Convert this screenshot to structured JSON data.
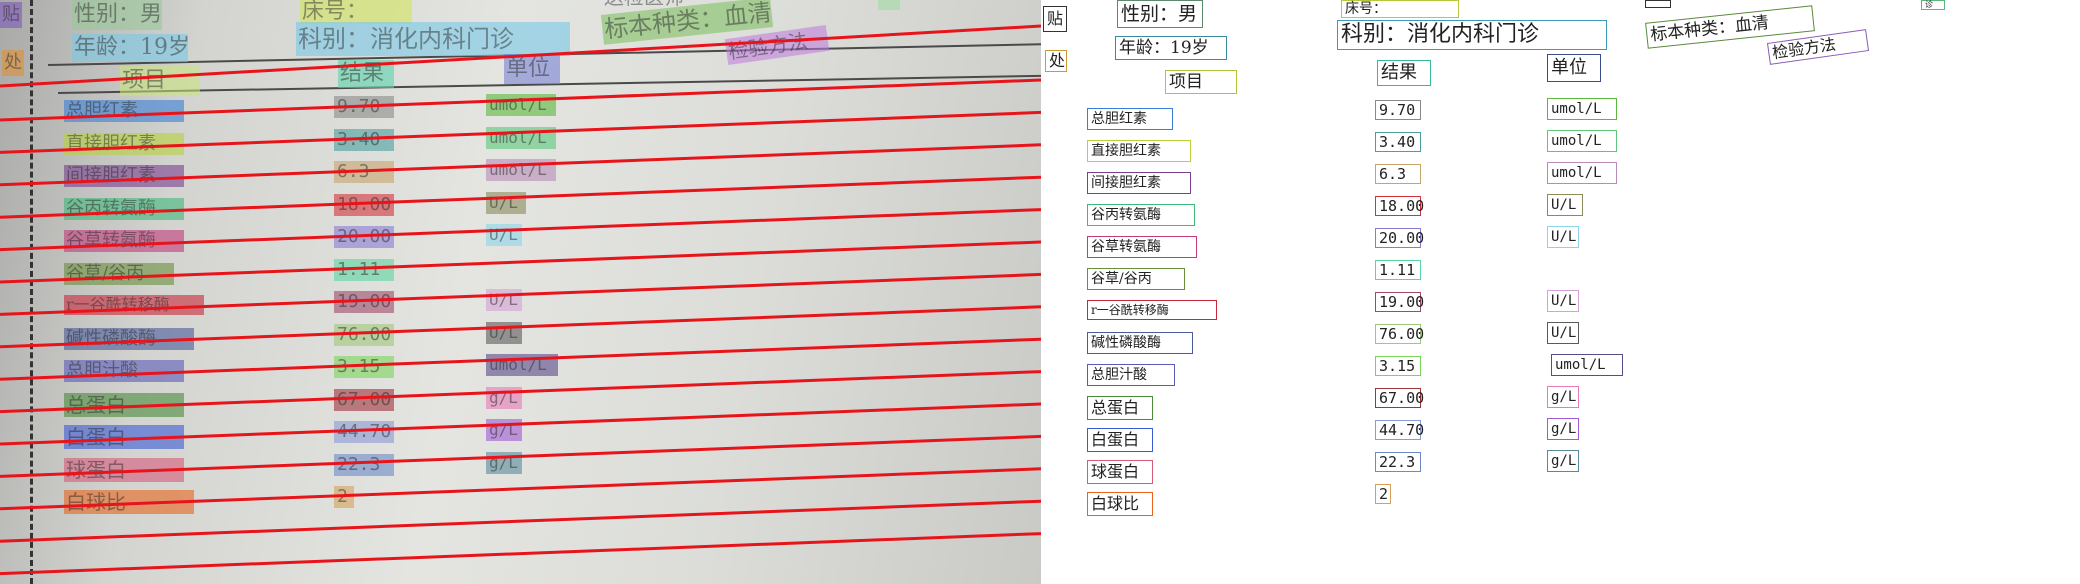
{
  "header": {
    "tie": "贴",
    "chu": "处",
    "gender": "性别：男",
    "age": "年龄：19岁",
    "bed": "床号：",
    "dept": "科别：消化内科门诊",
    "specimen": "标本种类：血清",
    "method": "检验方法",
    "hospital_fragment": "送检医师",
    "cut_fragment": "诊"
  },
  "columns": {
    "item": "项目",
    "result": "结果",
    "unit": "单位"
  },
  "rows": [
    {
      "name": "总胆红素",
      "result": "9.70",
      "unit": "umol/L"
    },
    {
      "name": "直接胆红素",
      "result": "3.40",
      "unit": "umol/L"
    },
    {
      "name": "间接胆红素",
      "result": "6.3",
      "unit": "umol/L"
    },
    {
      "name": "谷丙转氨酶",
      "result": "18.00",
      "unit": "U/L"
    },
    {
      "name": "谷草转氨酶",
      "result": "20.00",
      "unit": "U/L"
    },
    {
      "name": "谷草/谷丙",
      "result": "1.11",
      "unit": ""
    },
    {
      "name": "r一谷酰转移酶",
      "result": "19.00",
      "unit": "U/L"
    },
    {
      "name": "碱性磷酸酶",
      "result": "76.00",
      "unit": "U/L"
    },
    {
      "name": "总胆汁酸",
      "result": "3.15",
      "unit": "umol/L"
    },
    {
      "name": "总蛋白",
      "result": "67.00",
      "unit": "g/L"
    },
    {
      "name": "白蛋白",
      "result": "44.70",
      "unit": "g/L"
    },
    {
      "name": "球蛋白",
      "result": "22.3",
      "unit": "g/L"
    },
    {
      "name": "白球比",
      "result": "2",
      "unit": ""
    }
  ],
  "colors": {
    "overlay_line": "#e8141c",
    "name_box": [
      "#3a7fd6",
      "#b5d23a",
      "#7a3f8e",
      "#3fb87a",
      "#c23b7a",
      "#6a8f3a",
      "#c8283a",
      "#4a5a9a",
      "#5a5ab8",
      "#4a8a3a",
      "#3a5ad6",
      "#d65a7a",
      "#e8641c"
    ],
    "result_box": [
      "#8a8a8a",
      "#4aa0a0",
      "#c8a46a",
      "#d6323a",
      "#8a7ad6",
      "#5ad6a0",
      "#a04a6a",
      "#a0c87a",
      "#7ad65a",
      "#a0323a",
      "#8a9ad6",
      "#6a8ac8",
      "#d6a05a"
    ],
    "unit_box": [
      "#5ab83a",
      "#5ac87a",
      "#b88ab8",
      "#8a8a5a",
      "#8ad6e8",
      "",
      "#d6a0d6",
      "#5a5a5a",
      "#5a4a8a",
      "#e87ab8",
      "#a05ad6",
      "#5a8a9a",
      ""
    ]
  }
}
